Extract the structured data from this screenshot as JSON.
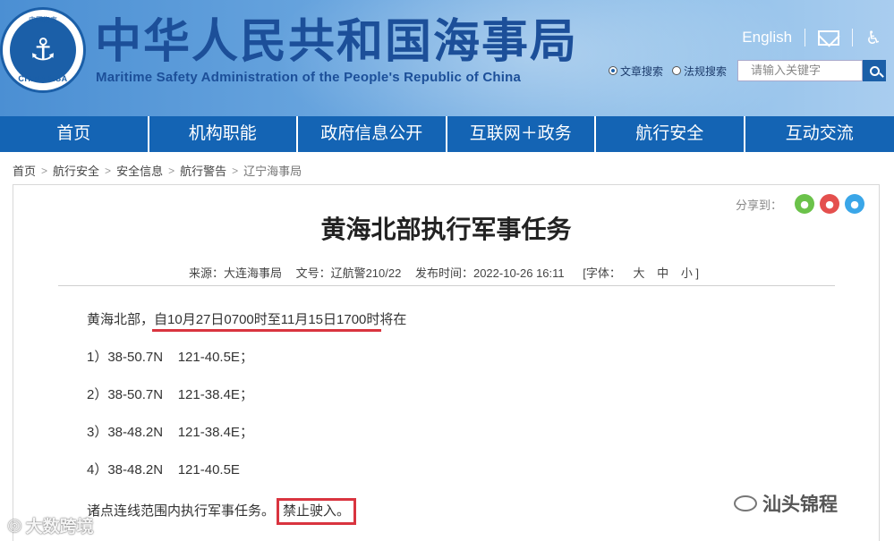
{
  "header": {
    "logo_top_text": "中国海事",
    "logo_text": "CHINA MSA",
    "title": "中华人民共和国海事局",
    "subtitle": "Maritime Safety Administration of the People's Republic of China",
    "english_link": "English",
    "search": {
      "option_article": "文章搜索",
      "option_law": "法规搜索",
      "placeholder": "请输入关键字"
    }
  },
  "nav": {
    "items": [
      "首页",
      "机构职能",
      "政府信息公开",
      "互联网＋政务",
      "航行安全",
      "互动交流"
    ]
  },
  "breadcrumb": {
    "items": [
      "首页",
      "航行安全",
      "安全信息",
      "航行警告",
      "辽宁海事局"
    ],
    "separator": ">"
  },
  "share": {
    "label": "分享到："
  },
  "article": {
    "title": "黄海北部执行军事任务",
    "meta": {
      "source": "来源：大连海事局",
      "doc_no": "文号：辽航警210/22",
      "published": "发布时间：2022-10-26 16:11",
      "font_label": "[字体：",
      "font_large": "大",
      "font_medium": "中",
      "font_small": "小 ]"
    },
    "intro_prefix": "黄海北部，",
    "intro_highlight": "自10月27日0700时至11月15日1700时",
    "intro_suffix": "将在",
    "points": [
      "1）38-50.7N    121-40.5E；",
      "2）38-50.7N    121-38.4E；",
      "3）38-48.2N    121-38.4E；",
      "4）38-48.2N    121-40.5E"
    ],
    "closing_prefix": "诸点连线范围内执行军事任务。",
    "closing_boxed": "禁止驶入。"
  },
  "watermarks": {
    "left": "大数跨境",
    "right": "汕头锦程"
  },
  "colors": {
    "nav_bg": "#1464b4",
    "title_blue": "#1c4f99",
    "highlight_red": "#d9343f"
  }
}
